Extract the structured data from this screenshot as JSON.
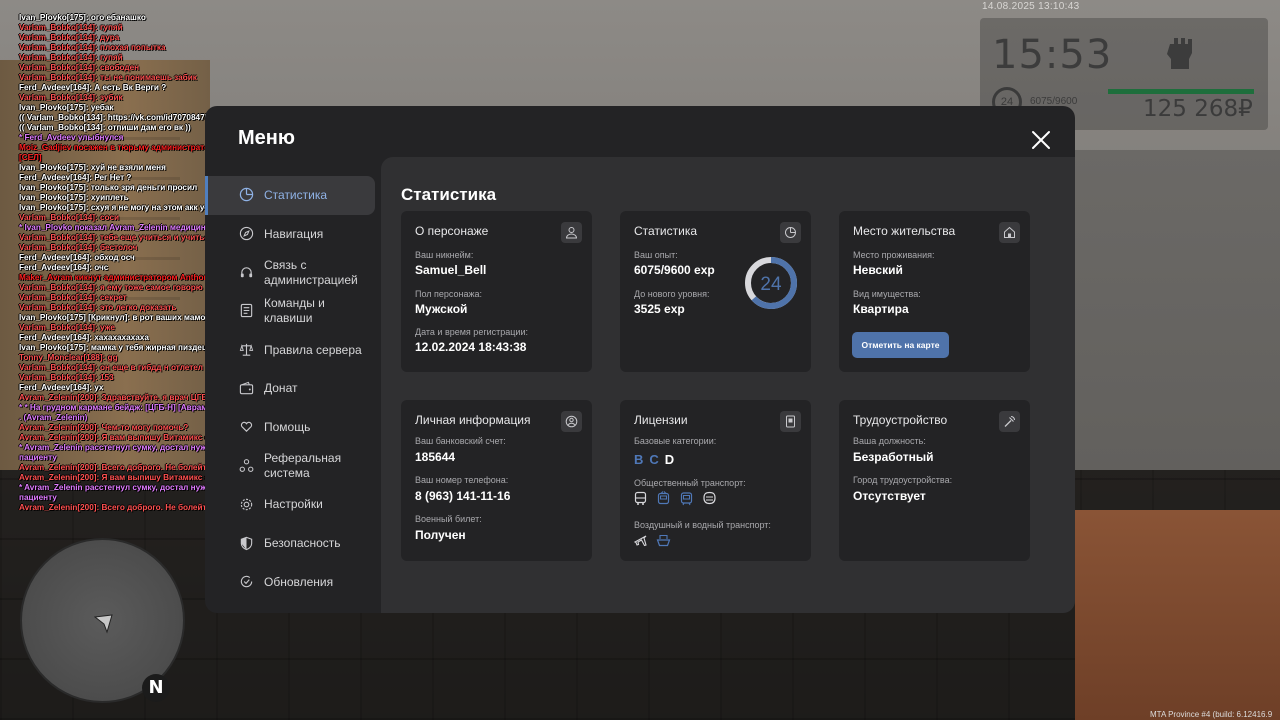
{
  "hud": {
    "datetime": "14.08.2025 13:10:43",
    "clock": "15:53",
    "level": "24",
    "exp": "6075/9600",
    "money": "125 268₽",
    "build": "MTA Province #4 (build: 6.12416.9"
  },
  "chat": [
    {
      "text": "Ivan_Plovko[175]: ого ебанашко",
      "color": "#ffffff"
    },
    {
      "text": "Varlam_Bobko[134]: гупяй",
      "color": "#ff5050"
    },
    {
      "text": "Varlam_Bobko[134]: дура",
      "color": "#ff5050"
    },
    {
      "text": "Varlam_Bobko[134]: плохая попытка",
      "color": "#ff5050"
    },
    {
      "text": "Varlam_Bobko[134]: гупяй",
      "color": "#ff5050"
    },
    {
      "text": "Varlam_Bobko[134]: свободен",
      "color": "#ff5050"
    },
    {
      "text": "Varlam_Bobko[134]: ты не понимаешь забик",
      "color": "#ff5050"
    },
    {
      "text": "Ferd_Avdeev[164]: А есть Вк Верги ?",
      "color": "#ffffff"
    },
    {
      "text": "Varlam_Bobko[134]: зубик",
      "color": "#ff5050"
    },
    {
      "text": "Ivan_Plovko[175]: уебак",
      "color": "#ffffff"
    },
    {
      "text": "(( Varlam_Bobko[134]: https://vk.com/id707084755 ))",
      "color": "#ffffff"
    },
    {
      "text": "(( Varlam_Bobko[134]: отпиши дам его вк ))",
      "color": "#ffffff"
    },
    {
      "text": " * Ferd_Avdeev улыбнулся",
      "color": "#e07bff"
    },
    {
      "text": "Moiz_Gadjiev посажен в тюрьму администратором Anthony_Manrique (30 мин.)",
      "color": "#ff2020"
    },
    {
      "text": "[СЕЛ]",
      "color": "#ff2020"
    },
    {
      "text": "Ivan_Plovko[175]: хуй не взяли меня",
      "color": "#ffffff"
    },
    {
      "text": "Ferd_Avdeev[164]: Рег Нет ?",
      "color": "#ffffff"
    },
    {
      "text": "Ivan_Plovko[175]: только зря деньги просил",
      "color": "#ffffff"
    },
    {
      "text": "Ivan_Plovko[175]: хуиплеть",
      "color": "#ffffff"
    },
    {
      "text": "Ivan_Plovko[175]: схуя я не могу на этом акк устроится",
      "color": "#ffffff"
    },
    {
      "text": "Varlam_Bobko[134]: соси",
      "color": "#ff5050"
    },
    {
      "text": " * Ivan_Plovko показал Avram_Zelenin медицинскую карту",
      "color": "#e07bff"
    },
    {
      "text": "Varlam_Bobko[134]: тебе еще учиться и учиться",
      "color": "#ff5050"
    },
    {
      "text": "Varlam_Bobko[134]: бестолоч",
      "color": "#ff5050"
    },
    {
      "text": "Ferd_Avdeev[164]: обход осч",
      "color": "#ffffff"
    },
    {
      "text": "Ferd_Avdeev[164]: очс",
      "color": "#ffffff"
    },
    {
      "text": "Maker_Avram кикнут администратором Anthony_Manrique (AFK от 3x)",
      "color": "#ff2020"
    },
    {
      "text": "Varlam_Bobko[134]: я ему тоже самое говорю",
      "color": "#ff5050"
    },
    {
      "text": "Varlam_Bobko[134]: секрет",
      "color": "#ff5050"
    },
    {
      "text": "Varlam_Bobko[134]: это легко доказать",
      "color": "#ff5050"
    },
    {
      "text": "Ivan_Plovko[175] [Крикнул]: в рот ваших мамок ебал",
      "color": "#ffffff"
    },
    {
      "text": "Varlam_Bobko[134]: уже",
      "color": "#ff5050"
    },
    {
      "text": "Ferd_Avdeev[164]: хахахахахаха",
      "color": "#ffffff"
    },
    {
      "text": "Ivan_Plovko[175]: мамка у тебя жирная пиздец",
      "color": "#ffffff"
    },
    {
      "text": "Tonny_Monclear[188]: gg",
      "color": "#ff5050"
    },
    {
      "text": "Varlam_Bobko[134]: он еще в гибдд н отлетел",
      "color": "#ff5050"
    },
    {
      "text": "Varlam_Bobko[134]: 153",
      "color": "#ff5050"
    },
    {
      "text": "Ferd_Avdeev[164]: ух",
      "color": "#ffffff"
    },
    {
      "text": "Avram_Zelenin[200]: Здравствуйте, я врач ЦГБ-Н Аврам Зеленин",
      "color": "#ff5050"
    },
    {
      "text": " * * На грудном кармане бейдж: [ЦГБ-Н] [Аврам Зеленин] [Врач-Терапевт] [ОКНП]",
      "color": "#e07bff"
    },
    {
      "text": " . (Avram_Zelenin)",
      "color": "#e07bff"
    },
    {
      "text": "Avram_Zelenin[200]: Чем-то могу помочь?",
      "color": "#ff5050"
    },
    {
      "text": "Avram_Zelenin[200]: Я вам выпишу Витамикс стоимостью 500р. Вы согласны?",
      "color": "#ff5050"
    },
    {
      "text": " * Avram_Zelenin расстегнул сумку, достал нужный препарат и передал его",
      "color": "#e07bff"
    },
    {
      "text": "пациенту",
      "color": "#e07bff"
    },
    {
      "text": "Avram_Zelenin[200]: Всего доброго. Не болейте!",
      "color": "#ff5050"
    },
    {
      "text": "Avram_Zelenin[200]: Я вам выпишу Витамикс стоимостью 500р. Вы согласны?",
      "color": "#ff5050"
    },
    {
      "text": " * Avram_Zelenin расстегнул сумку, достал нужный препарат и передал его",
      "color": "#e07bff"
    },
    {
      "text": "пациенту",
      "color": "#e07bff"
    },
    {
      "text": "Avram_Zelenin[200]: Всего доброго. Не болейте!",
      "color": "#ff5050"
    }
  ],
  "menu": {
    "title": "Меню",
    "sidebar": [
      {
        "label": "Статистика",
        "icon": "chart-pie-icon",
        "active": true
      },
      {
        "label": "Навигация",
        "icon": "compass-icon"
      },
      {
        "label": "Связь с администрацией",
        "icon": "headset-icon"
      },
      {
        "label": "Команды и клавиши",
        "icon": "keyboard-icon"
      },
      {
        "label": "Правила сервера",
        "icon": "scales-icon"
      },
      {
        "label": "Донат",
        "icon": "wallet-icon"
      },
      {
        "label": "Помощь",
        "icon": "hand-heart-icon"
      },
      {
        "label": "Реферальная система",
        "icon": "referral-icon"
      },
      {
        "label": "Настройки",
        "icon": "gear-icon"
      },
      {
        "label": "Безопасность",
        "icon": "shield-icon"
      },
      {
        "label": "Обновления",
        "icon": "refresh-check-icon"
      }
    ],
    "content_title": "Статистика",
    "cards": {
      "character": {
        "title": "О персонаже",
        "nickname_label": "Ваш никнейм:",
        "nickname": "Samuel_Bell",
        "gender_label": "Пол персонажа:",
        "gender": "Мужской",
        "reg_label": "Дата и время регистрации:",
        "reg": "12.02.2024 18:43:38"
      },
      "stats": {
        "title": "Статистика",
        "exp_label": "Ваш опыт:",
        "exp": "6075/9600 exp",
        "next_label": "До нового уровня:",
        "next": "3525 exp",
        "level": "24",
        "progress": 0.633
      },
      "residence": {
        "title": "Место жительства",
        "place_label": "Место проживания:",
        "place": "Невский",
        "type_label": "Вид имущества:",
        "type": "Квартира",
        "map_button": "Отметить на карте"
      },
      "personal": {
        "title": "Личная информация",
        "bank_label": "Ваш банковский счет:",
        "bank": "185644",
        "phone_label": "Ваш номер телефона:",
        "phone": "8 (963) 141-11-16",
        "military_label": "Военный билет:",
        "military": "Получен"
      },
      "licenses": {
        "title": "Лицензии",
        "base_label": "Базовые категории:",
        "categories": [
          {
            "letter": "B",
            "color": "#4f78b8"
          },
          {
            "letter": "C",
            "color": "#4f78b8"
          },
          {
            "letter": "D",
            "color": "#ffffff"
          }
        ],
        "public_label": "Общественный транспорт:",
        "public_icons": [
          "bus-icon",
          "trolleybus-icon",
          "tram-icon",
          "subway-icon"
        ],
        "air_label": "Воздушный и водный транспорт:",
        "air_icons": [
          "plane-icon",
          "boat-icon"
        ]
      },
      "job": {
        "title": "Трудоустройство",
        "position_label": "Ваша должность:",
        "position": "Безработный",
        "city_label": "Город трудоустройства:",
        "city": "Отсутствует"
      }
    }
  },
  "colors": {
    "accent": "#4f73aa",
    "modal_bg": "#232325",
    "content_bg": "#303032",
    "chat_red": "#ff5050",
    "chat_pink": "#e07bff"
  }
}
